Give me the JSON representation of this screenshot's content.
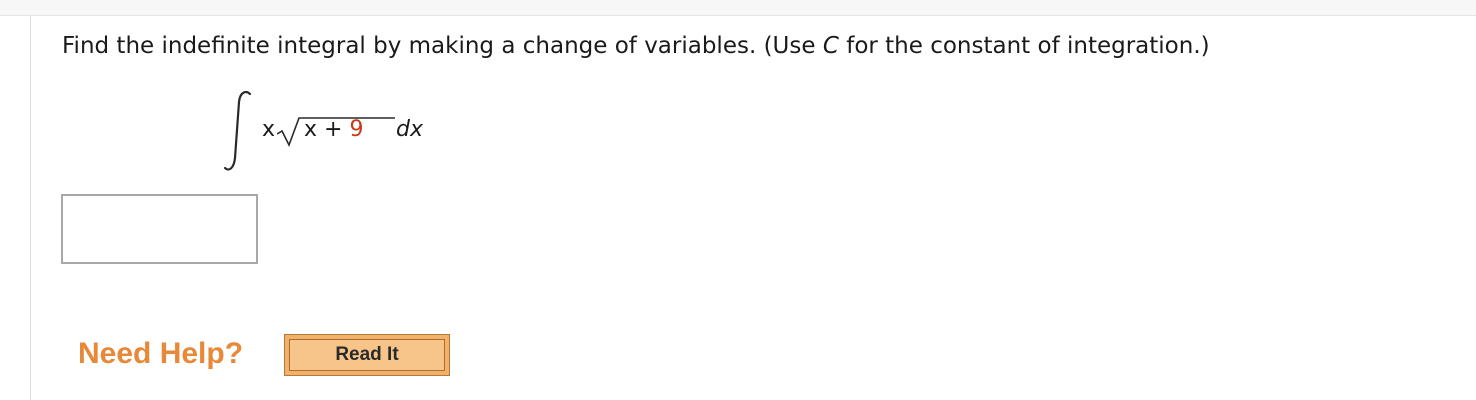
{
  "question": {
    "prefix": "Find the indefinite integral by making a change of variables. (Use ",
    "constant_symbol": "C",
    "suffix": " for the constant of integration.)"
  },
  "integral": {
    "outer_factor": "x",
    "radicand_var": "x",
    "radicand_op": " + ",
    "radicand_const": "9",
    "differential": "dx",
    "highlight_color": "#c8391c"
  },
  "answer": {
    "value": ""
  },
  "help": {
    "label": "Need Help?",
    "read_it_label": "Read It",
    "accent_color": "#e8893a"
  }
}
